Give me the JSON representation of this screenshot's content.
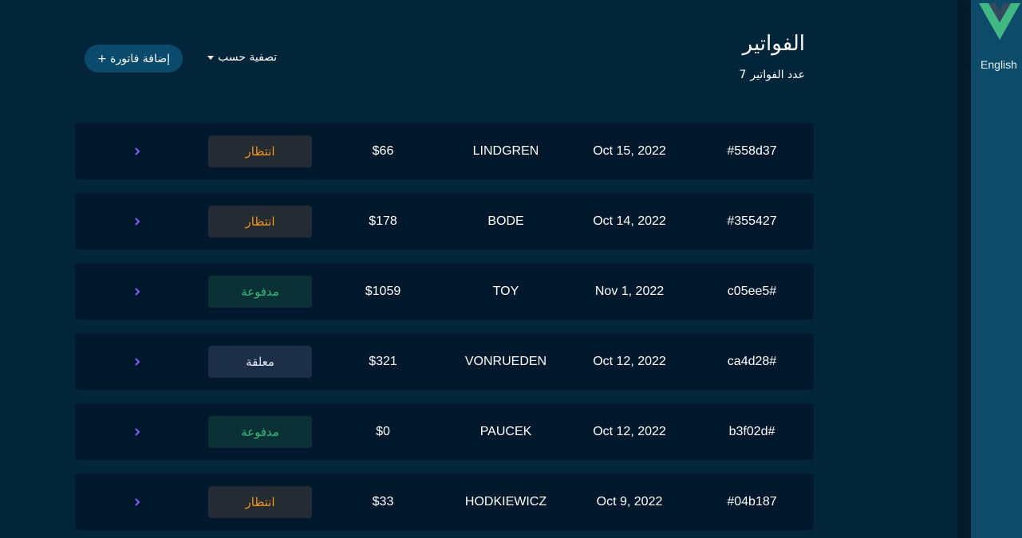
{
  "header": {
    "title": "الفواتير",
    "count_label": "عدد الفواتير",
    "count_value": "7",
    "filter_label": "تصفية حسب",
    "add_button_label": "إضافة فاتورة +"
  },
  "sidebar": {
    "language_label": "English",
    "logo_icon": "vue-logo-icon"
  },
  "status_colors": {
    "pending": {
      "bg": "#242b33",
      "fg": "#f0941c"
    },
    "paid": {
      "bg": "#0b3136",
      "fg": "#32b97a"
    },
    "draft": {
      "bg": "#1d2f47",
      "fg": "#dfe6ee"
    }
  },
  "accent_color": "#7c5dfa",
  "invoices": [
    {
      "id": "#558d37",
      "date": "Oct 15, 2022",
      "client": "LINDGREN",
      "amount": "$66",
      "status": "انتظار",
      "status_type": "pending"
    },
    {
      "id": "#355427",
      "date": "Oct 14, 2022",
      "client": "BODE",
      "amount": "$178",
      "status": "انتظار",
      "status_type": "pending"
    },
    {
      "id": "c05ee5#",
      "date": "Nov 1, 2022",
      "client": "TOY",
      "amount": "$1059",
      "status": "مدفوعة",
      "status_type": "paid"
    },
    {
      "id": "ca4d28#",
      "date": "Oct 12, 2022",
      "client": "VONRUEDEN",
      "amount": "$321",
      "status": "معلقة",
      "status_type": "draft"
    },
    {
      "id": "b3f02d#",
      "date": "Oct 12, 2022",
      "client": "PAUCEK",
      "amount": "$0",
      "status": "مدفوعة",
      "status_type": "paid"
    },
    {
      "id": "#04b187",
      "date": "Oct 9, 2022",
      "client": "HODKIEWICZ",
      "amount": "$33",
      "status": "انتظار",
      "status_type": "pending"
    }
  ]
}
